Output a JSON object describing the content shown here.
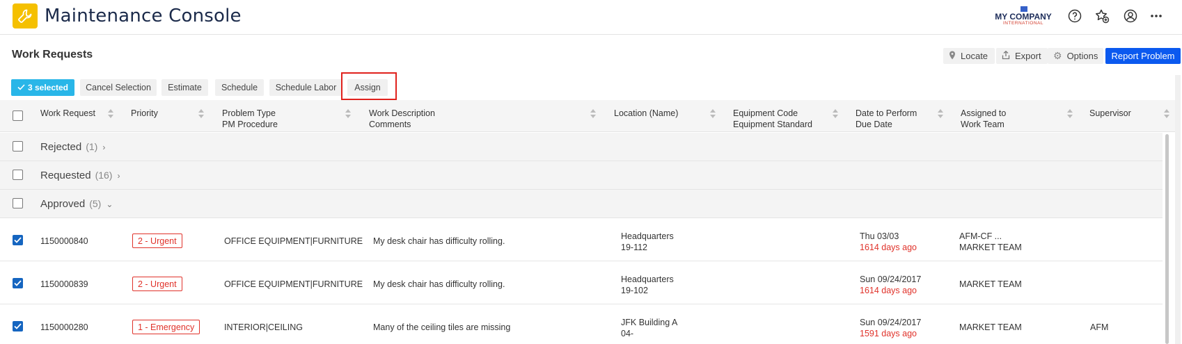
{
  "app": {
    "title": "Maintenance Console"
  },
  "company": {
    "name": "MY COMPANY",
    "sub": "INTERNATIONAL"
  },
  "colors": {
    "accent": "#0b59ef",
    "selection": "#29b6e8",
    "urgent": "#e0322a",
    "logo": "#f5c000",
    "highlight_outline": "#e0211c"
  },
  "page": {
    "title": "Work Requests"
  },
  "header_actions": {
    "locate": "Locate",
    "export": "Export",
    "options": "Options",
    "report": "Report Problem"
  },
  "actions": {
    "selected": "3 selected",
    "cancel": "Cancel Selection",
    "estimate": "Estimate",
    "schedule": "Schedule",
    "schedule_labor": "Schedule Labor",
    "assign": "Assign"
  },
  "columns": {
    "work_request": "Work Request",
    "priority": "Priority",
    "problem_type": "Problem Type",
    "pm_procedure": "PM Procedure",
    "work_description": "Work Description",
    "comments": "Comments",
    "location": "Location (Name)",
    "equipment_code": "Equipment Code",
    "equipment_standard": "Equipment Standard",
    "date_to_perform": "Date to Perform",
    "due_date": "Due Date",
    "assigned_to": "Assigned to",
    "work_team": "Work Team",
    "supervisor": "Supervisor"
  },
  "groups": [
    {
      "label": "Rejected",
      "count": "(1)",
      "chevron": "›"
    },
    {
      "label": "Requested",
      "count": "(16)",
      "chevron": "›"
    },
    {
      "label": "Approved",
      "count": "(5)",
      "chevron": "⌄"
    }
  ],
  "rows": [
    {
      "id": "1150000840",
      "priority": "2 - Urgent",
      "problem": "OFFICE EQUIPMENT|FURNITURE",
      "description": "My desk chair has difficulty rolling.",
      "location_1": "Headquarters",
      "location_2": "19-112",
      "date": "Thu 03/03",
      "due": "1614 days ago",
      "assigned_1": "AFM-CF ...",
      "assigned_2": "MARKET TEAM",
      "supervisor": ""
    },
    {
      "id": "1150000839",
      "priority": "2 - Urgent",
      "problem": "OFFICE EQUIPMENT|FURNITURE",
      "description": "My desk chair has difficulty rolling.",
      "location_1": "Headquarters",
      "location_2": "19-102",
      "date": "Sun 09/24/2017",
      "due": "1614 days ago",
      "assigned_1": "MARKET TEAM",
      "assigned_2": "",
      "supervisor": ""
    },
    {
      "id": "1150000280",
      "priority": "1 - Emergency",
      "problem": "INTERIOR|CEILING",
      "description": "Many of the ceiling tiles are missing",
      "location_1": "JFK Building A",
      "location_2": "04-",
      "date": "Sun 09/24/2017",
      "due": "1591 days ago",
      "assigned_1": "MARKET TEAM",
      "assigned_2": "",
      "supervisor": "AFM"
    }
  ]
}
